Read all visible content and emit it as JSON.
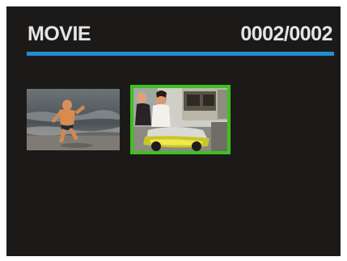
{
  "header": {
    "title": "MOVIE",
    "counter": "0002/0002"
  },
  "colors": {
    "background": "#1c1a19",
    "rule": "#1f8fd0",
    "selection": "#40c020",
    "text": "#e4e4e4"
  },
  "thumbnails": [
    {
      "icon": "movie-thumbnail-beach",
      "selected": false
    },
    {
      "icon": "movie-thumbnail-couple",
      "selected": true
    }
  ]
}
